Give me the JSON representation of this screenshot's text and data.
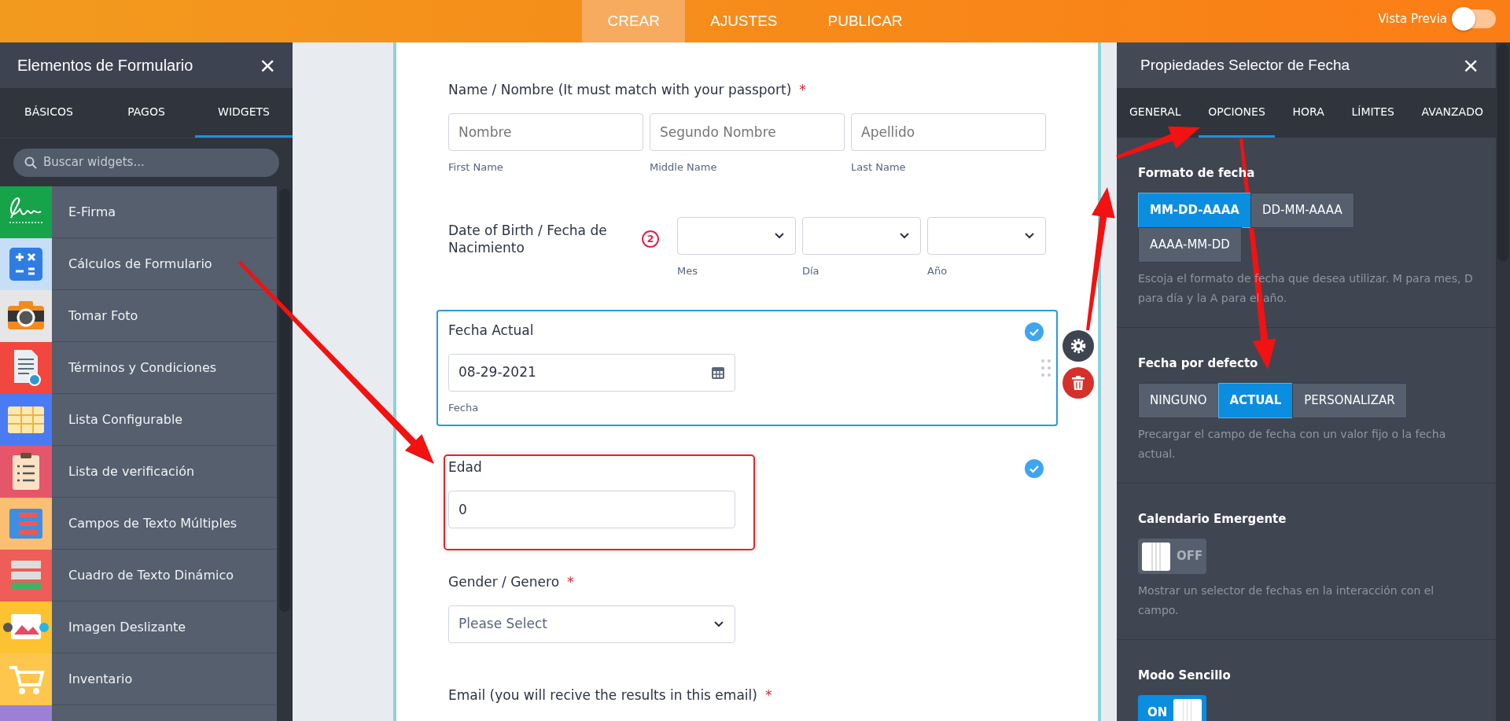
{
  "top_bar": {
    "tabs": [
      {
        "label": "CREAR",
        "selected": true
      },
      {
        "label": "AJUSTES",
        "selected": false
      },
      {
        "label": "PUBLICAR",
        "selected": false
      }
    ],
    "preview": {
      "label": "Vista Previa",
      "on": false
    }
  },
  "left_panel": {
    "title": "Elementos de Formulario",
    "close": "×",
    "tabs": [
      {
        "label": "BÁSICOS",
        "selected": false
      },
      {
        "label": "PAGOS",
        "selected": false
      },
      {
        "label": "WIDGETS",
        "selected": true
      }
    ],
    "search": {
      "placeholder": "Buscar widgets..."
    },
    "widgets": [
      {
        "label": "E-Firma",
        "color": "#17a34a"
      },
      {
        "label": "Cálculos de Formulario",
        "color": "#c7def7"
      },
      {
        "label": "Tomar Foto",
        "color": "#e6e6e6"
      },
      {
        "label": "Términos y Condiciones",
        "color": "#f2473f"
      },
      {
        "label": "Lista Configurable",
        "color": "#4b7bf3"
      },
      {
        "label": "Lista de verificación",
        "color": "#e5566b"
      },
      {
        "label": "Campos de Texto Múltiples",
        "color": "#fcbf72"
      },
      {
        "label": "Cuadro de Texto Dinámico",
        "color": "#ee5d58"
      },
      {
        "label": "Imagen Deslizante",
        "color": "#fdc22f"
      },
      {
        "label": "Inventario",
        "color": "#fec64c"
      },
      {
        "color": "#9b80d4"
      }
    ]
  },
  "form": {
    "fields": [
      {
        "kind": "name",
        "label": "Name / Nombre (It must match with your passport)",
        "required_mark": "*",
        "selected": false,
        "verified": false,
        "highlighted": false,
        "inputs": [
          {
            "placeholder": "Nombre",
            "sublabel": "First Name"
          },
          {
            "placeholder": "Segundo Nombre",
            "sublabel": "Middle Name"
          },
          {
            "placeholder": "Apellido",
            "sublabel": "Last Name"
          }
        ]
      },
      {
        "kind": "date_selects",
        "label": "Date of Birth / Fecha de Nacimiento",
        "badge": "2",
        "selected": false,
        "verified": false,
        "highlighted": false,
        "selects": [
          {
            "sublabel": "Mes"
          },
          {
            "sublabel": "Día"
          },
          {
            "sublabel": "Año"
          }
        ]
      },
      {
        "kind": "date_input",
        "label": "Fecha Actual",
        "value": "08-29-2021",
        "sublabel": "Fecha",
        "selected": true,
        "verified": true,
        "highlighted": false
      },
      {
        "kind": "number",
        "label": "Edad",
        "value": "0",
        "selected": false,
        "verified": true,
        "highlighted": true
      },
      {
        "kind": "select",
        "label": "Gender / Genero",
        "required_mark": "*",
        "placeholder": "Please Select",
        "selected": false,
        "verified": false,
        "highlighted": false
      },
      {
        "kind": "label_only",
        "label": "Email (you will recive the results in this email)",
        "required_mark": "*",
        "selected": false,
        "verified": false,
        "highlighted": false
      }
    ]
  },
  "right_panel": {
    "title": "Propiedades Selector de Fecha",
    "close": "×",
    "tabs": [
      {
        "label": "GENERAL",
        "selected": false
      },
      {
        "label": "OPCIONES",
        "selected": true
      },
      {
        "label": "HORA",
        "selected": false
      },
      {
        "label": "LÍMITES",
        "selected": false
      },
      {
        "label": "AVANZADO",
        "selected": false
      }
    ],
    "sections": [
      {
        "kind": "segmented",
        "title": "Formato de fecha",
        "options": [
          {
            "label": "MM-DD-AAAA",
            "selected": true
          },
          {
            "label": "DD-MM-AAAA",
            "selected": false
          },
          {
            "label": "AAAA-MM-DD",
            "selected": false
          }
        ],
        "description": "Escoja el formato de fecha que desea utilizar. M para mes, D para día y la A para el año."
      },
      {
        "kind": "segmented",
        "title": "Fecha por defecto",
        "options": [
          {
            "label": "NINGUNO",
            "selected": false
          },
          {
            "label": "ACTUAL",
            "selected": true
          },
          {
            "label": "PERSONALIZAR",
            "selected": false
          }
        ],
        "description": "Precargar el campo de fecha con un valor fijo o la fecha actual."
      },
      {
        "kind": "toggle",
        "title": "Calendario Emergente",
        "on": false,
        "state_label": "OFF",
        "description": "Mostrar un selector de fechas en la interacción con el campo."
      },
      {
        "kind": "toggle",
        "title": "Modo Sencillo",
        "on": true,
        "state_label": "ON"
      }
    ]
  }
}
